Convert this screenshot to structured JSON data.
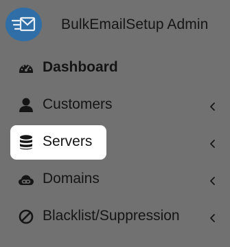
{
  "brand": {
    "title": "BulkEmailSetup Admin",
    "logo_icon": "envelope-lines-icon",
    "logo_color": "#2f6ea6"
  },
  "nav": {
    "items": [
      {
        "label": "Dashboard",
        "icon": "tachometer-icon",
        "active": false,
        "has_submenu": false
      },
      {
        "label": "Customers",
        "icon": "user-icon",
        "active": false,
        "has_submenu": true
      },
      {
        "label": "Servers",
        "icon": "database-icon",
        "active": true,
        "has_submenu": true
      },
      {
        "label": "Domains",
        "icon": "cloud-link-icon",
        "active": false,
        "has_submenu": true
      },
      {
        "label": "Blacklist/Suppression",
        "icon": "ban-icon",
        "active": false,
        "has_submenu": true
      }
    ]
  },
  "colors": {
    "background": "#717171",
    "active_item_bg": "#ffffff",
    "text": "#151515"
  }
}
